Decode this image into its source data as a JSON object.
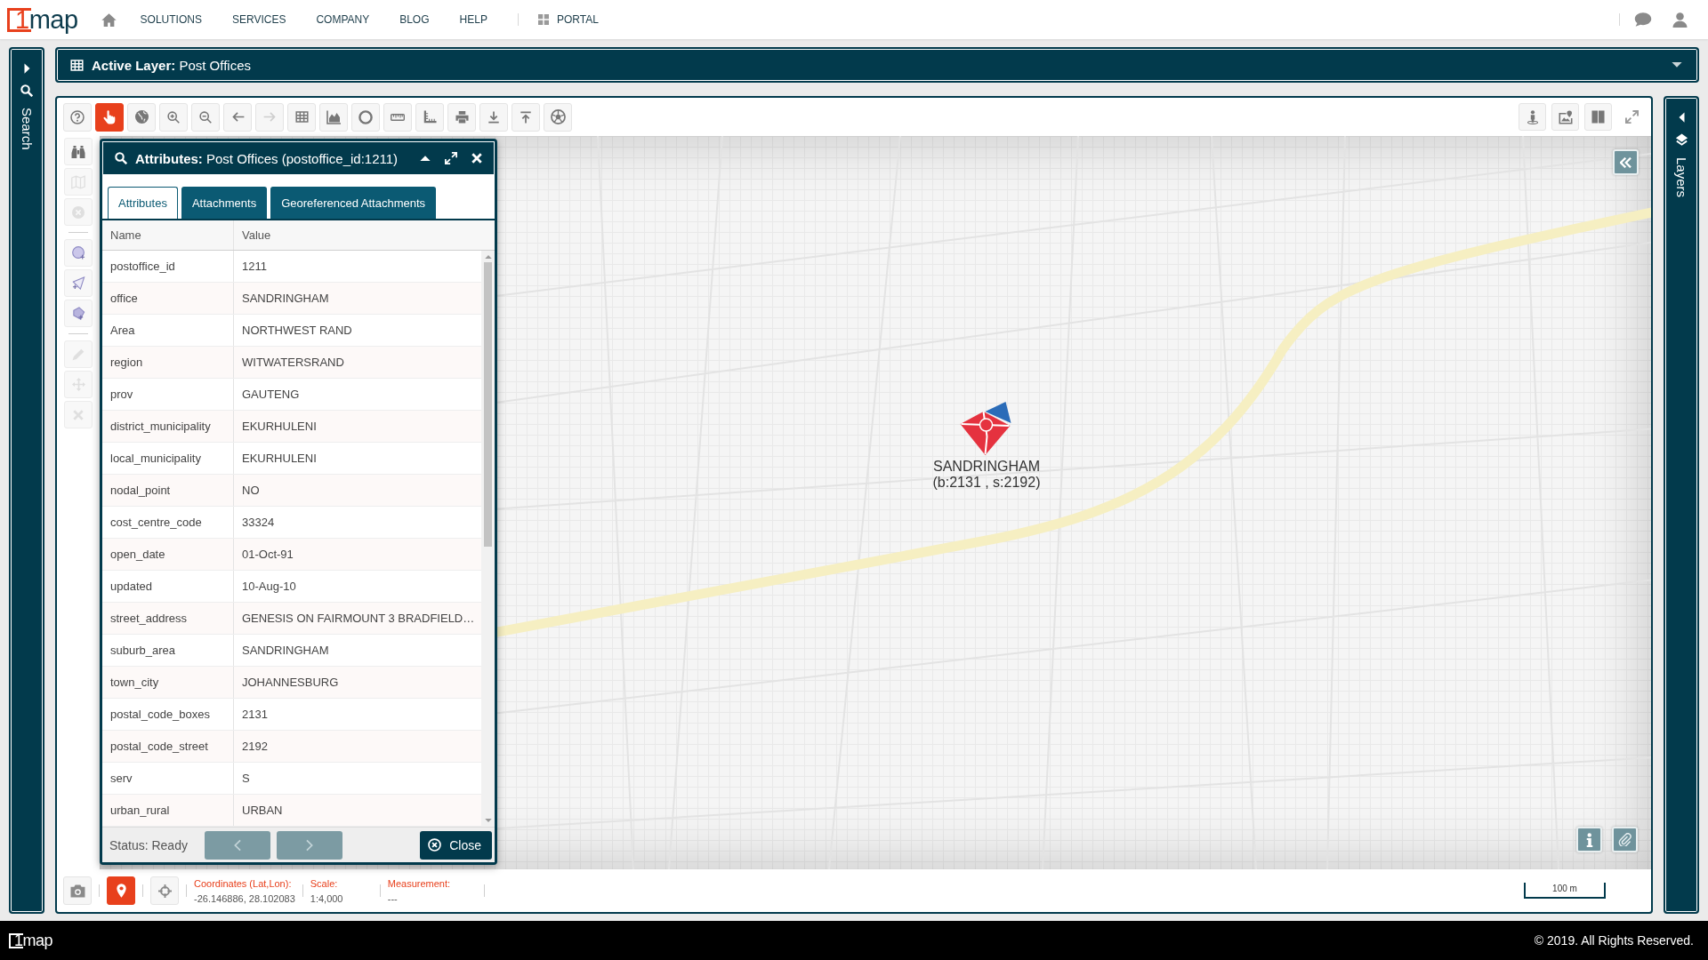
{
  "top_nav": {
    "logo": "1map",
    "links": [
      {
        "label": "SOLUTIONS"
      },
      {
        "label": "SERVICES"
      },
      {
        "label": "COMPANY"
      },
      {
        "label": "BLOG"
      },
      {
        "label": "HELP"
      }
    ],
    "portal": {
      "label": "PORTAL"
    }
  },
  "search_panel": {
    "label": "Search"
  },
  "active_layer": {
    "title": "**Active Layer:** Post Offices"
  },
  "map_toolbar": {
    "tools": [
      {
        "selected": false,
        "disabled": false
      },
      {
        "selected": true,
        "disabled": false
      },
      {
        "selected": false,
        "disabled": false
      },
      {
        "selected": false,
        "disabled": false
      },
      {
        "selected": false,
        "disabled": false
      },
      {
        "selected": false,
        "disabled": false
      },
      {
        "selected": false,
        "disabled": true
      },
      {
        "selected": false,
        "disabled": false
      },
      {
        "selected": false,
        "disabled": false
      },
      {
        "selected": false,
        "disabled": false
      },
      {
        "selected": false,
        "disabled": false
      },
      {
        "selected": false,
        "disabled": false
      },
      {
        "selected": false,
        "disabled": false
      },
      {
        "selected": false,
        "disabled": false
      },
      {
        "selected": false,
        "disabled": false
      },
      {
        "selected": false,
        "disabled": false
      }
    ]
  },
  "tool_column": {
    "tools": [
      {
        "disabled": false
      },
      {
        "disabled": true
      },
      {
        "disabled": true
      },
      {
        "disabled": false
      },
      {
        "disabled": false
      },
      {
        "disabled": false
      },
      {
        "disabled": true
      },
      {
        "disabled": true
      },
      {
        "disabled": true
      }
    ]
  },
  "attributes_panel": {
    "title": "**Attributes:** Post Offices (postoffice_id:1211)",
    "tabs": [
      {
        "label": "Attributes",
        "selected": true
      },
      {
        "label": "Attachments",
        "selected": false
      },
      {
        "label": "Georeferenced Attachments",
        "selected": false
      }
    ],
    "table": {
      "columns": [
        "Name",
        "Value"
      ],
      "rows": [
        {
          "name": "postoffice_id",
          "value": "1211"
        },
        {
          "name": "office",
          "value": "SANDRINGHAM"
        },
        {
          "name": "Area",
          "value": "NORTHWEST RAND"
        },
        {
          "name": "region",
          "value": "WITWATERSRAND"
        },
        {
          "name": "prov",
          "value": "GAUTENG"
        },
        {
          "name": "district_municipality",
          "value": "EKURHULENI"
        },
        {
          "name": "local_municipality",
          "value": "EKURHULENI"
        },
        {
          "name": "nodal_point",
          "value": "NO"
        },
        {
          "name": "cost_centre_code",
          "value": "33324"
        },
        {
          "name": "open_date",
          "value": "01-Oct-91"
        },
        {
          "name": "updated",
          "value": "10-Aug-10"
        },
        {
          "name": "street_address",
          "value": "GENESIS ON FAIRMOUNT 3 BRADFIELD…"
        },
        {
          "name": "suburb_area",
          "value": "SANDRINGHAM"
        },
        {
          "name": "town_city",
          "value": "JOHANNESBURG"
        },
        {
          "name": "postal_code_boxes",
          "value": "2131"
        },
        {
          "name": "postal_code_street",
          "value": "2192"
        },
        {
          "name": "serv",
          "value": "S"
        },
        {
          "name": "urban_rural",
          "value": "URBAN"
        }
      ]
    },
    "status": "Status: Ready",
    "prev_button": {
      "disabled": true
    },
    "next_button": {
      "disabled": true
    },
    "close_button": {
      "label": "Close"
    }
  },
  "map": {
    "marker": {
      "label": "SANDRINGHAM",
      "codes": "(b:2131 , s:2192)"
    }
  },
  "status_bar": {
    "tools": [
      {
        "selected": false
      },
      {
        "selected": true
      },
      {
        "selected": false
      }
    ],
    "coordinates": {
      "label": "Coordinates (Lat,Lon):",
      "value": "-26.146886, 28.102083"
    },
    "scale": {
      "label": "Scale:",
      "value": "1:4,000"
    },
    "measurement": {
      "label": "Measurement:",
      "value": "---"
    },
    "scale_bar": {
      "label": "100 m"
    }
  },
  "layers_panel": {
    "label": "Layers"
  },
  "footer": {
    "logo": "1map",
    "copyright": "© 2019. All Rights Reserved."
  }
}
